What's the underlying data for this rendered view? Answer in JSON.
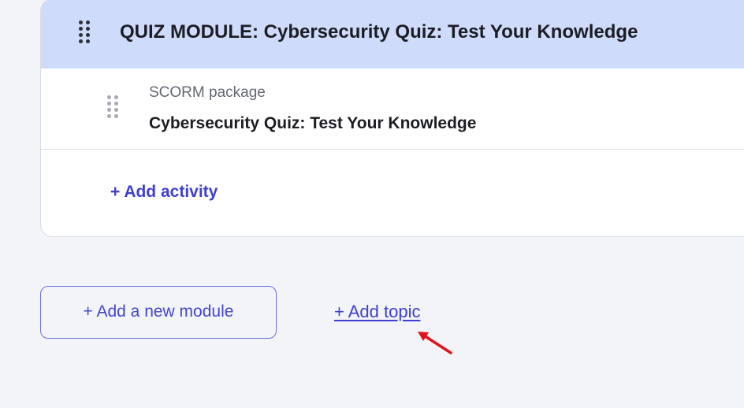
{
  "module": {
    "title": "QUIZ MODULE: Cybersecurity Quiz: Test Your Knowledge",
    "header_color": "#cfdbfb",
    "drag_icon": "drag-handle-icon",
    "activity": {
      "type_label": "SCORM package",
      "title": "Cybersecurity Quiz: Test Your Knowledge",
      "drag_icon": "drag-handle-icon"
    },
    "add_activity_label": "+ Add activity"
  },
  "actions": {
    "add_module_label": "+ Add a new module",
    "add_topic_label": "+ Add topic"
  },
  "colors": {
    "accent": "#3f3fd1",
    "annotation_arrow": "#e3131b",
    "page_background": "#f3f4f8"
  },
  "annotation": {
    "icon": "red-arrow-icon"
  }
}
